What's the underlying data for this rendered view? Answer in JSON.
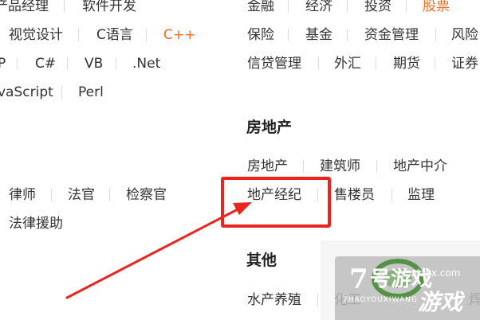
{
  "left_col": {
    "row1": [
      "产品经理",
      "软件开发"
    ],
    "row2": [
      "视觉设计",
      "C语言",
      "C++"
    ],
    "row3": [
      "P",
      "C#",
      "VB",
      ".Net"
    ],
    "row4": [
      "vaScript",
      "Perl"
    ],
    "law": [
      "律师",
      "法官",
      "检察官"
    ],
    "law2": [
      "法律援助"
    ]
  },
  "finance": {
    "row1": [
      "金融",
      "经济",
      "投资",
      "股票"
    ],
    "row2": [
      "保险",
      "基金",
      "资金管理",
      "风险"
    ],
    "row3": [
      "信贷管理",
      "外汇",
      "期货",
      "证券"
    ]
  },
  "real_estate": {
    "heading": "房地产",
    "row1": [
      "房地产",
      "建筑师",
      "地产中介"
    ],
    "row2": [
      "地产经纪",
      "售楼员",
      "监理"
    ]
  },
  "other": {
    "heading": "其他",
    "row1": [
      "水产养殖",
      "化工",
      "焊"
    ]
  },
  "watermark": {
    "number": "7",
    "brand_cn": "号游戏",
    "brand_py": "7HAOYOUXIWANG",
    "url": "xjayx.com",
    "title": "游戏"
  },
  "colors": {
    "accent": "#f26b21",
    "highlight_box": "#e8251f",
    "arrow": "#e8251f",
    "watermark_green": "#3f8a2f"
  }
}
